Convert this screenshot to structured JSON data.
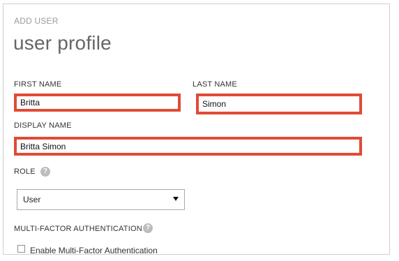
{
  "header": {
    "eyebrow": "ADD USER",
    "title": "user profile"
  },
  "form": {
    "first_name": {
      "label": "FIRST NAME",
      "value": "Britta"
    },
    "last_name": {
      "label": "LAST NAME",
      "value": "Simon"
    },
    "display_name": {
      "label": "DISPLAY NAME",
      "value": "Britta Simon"
    },
    "role": {
      "label": "ROLE",
      "help_icon": "?",
      "selected": "User"
    },
    "mfa": {
      "label": "MULTI-FACTOR AUTHENTICATION",
      "help_icon": "?",
      "checkbox_label": "Enable Multi-Factor Authentication",
      "checked": false
    }
  },
  "colors": {
    "highlight": "#e04b36",
    "muted_text": "#9a9a9a",
    "help_icon_bg": "#bdbdbd"
  },
  "icons": {
    "role_help": "help-icon",
    "mfa_help": "help-icon",
    "select_arrow": "chevron-down-icon"
  }
}
